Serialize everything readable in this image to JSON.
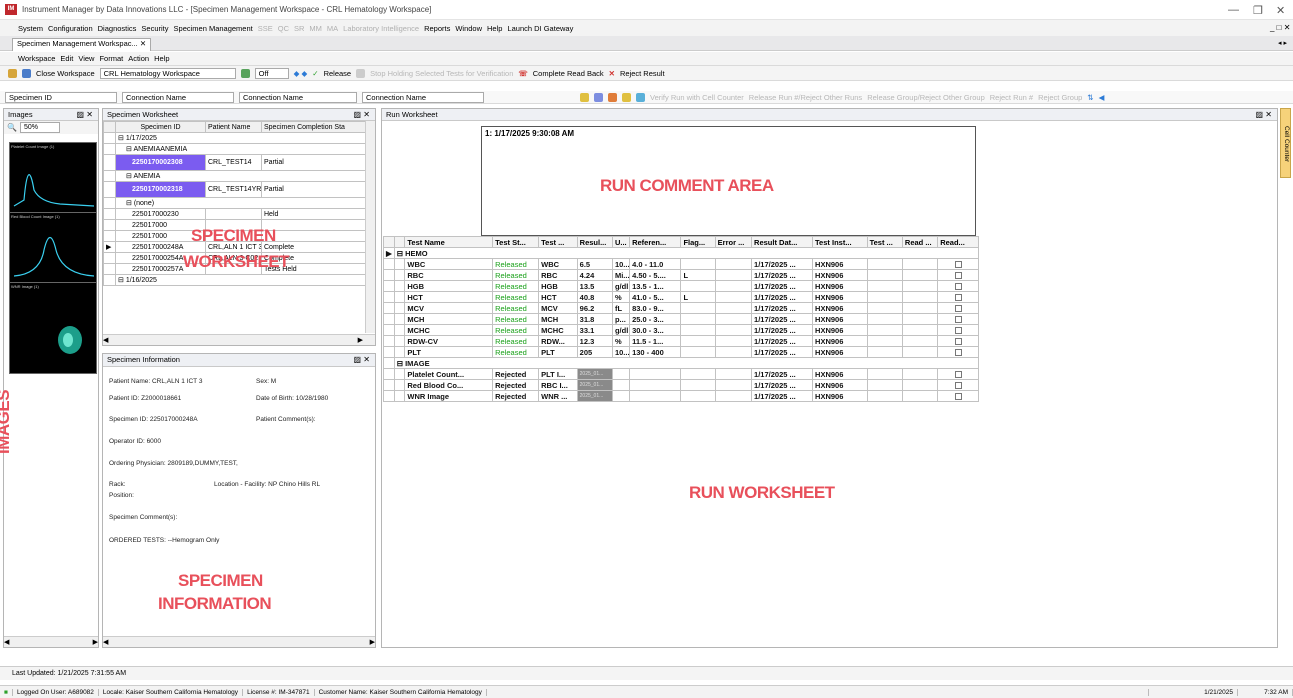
{
  "app": {
    "title": "Instrument Manager by Data Innovations LLC - [Specimen Management Workspace - CRL Hematology Workspace]",
    "logo": "IM"
  },
  "menubar": [
    "System",
    "Configuration",
    "Diagnostics",
    "Security",
    "Specimen Management",
    "SSE",
    "QC",
    "SR",
    "MM",
    "MA",
    "Laboratory Intelligence",
    "Reports",
    "Window",
    "Help",
    "Launch DI Gateway"
  ],
  "menubar_disabled": [
    "SSE",
    "QC",
    "SR",
    "MM",
    "MA",
    "Laboratory Intelligence"
  ],
  "doc_tab": {
    "label": "Specimen Management Workspac...",
    "close": "✕"
  },
  "nav_arrows": "◂ ▸",
  "toolbar1": {
    "items": [
      "Workspace",
      "Edit",
      "View",
      "Format",
      "Action",
      "Help"
    ]
  },
  "toolbar2": {
    "close_workspace": "Close Workspace",
    "workspace_select": "CRL Hematology Workspace",
    "off_select": "Off",
    "release": "Release",
    "stop_holding": "Stop Holding Selected Tests for Verification",
    "complete_read_back": "Complete Read Back",
    "reject_result": "Reject Result"
  },
  "toolbar3": {
    "specimen_id": "Specimen ID",
    "connection1": "Connection Name",
    "connection2": "Connection Name",
    "connection3": "Connection Name",
    "verify_run": "Verify Run with Cell Counter",
    "release_run": "Release Run #/Reject Other Runs",
    "release_group": "Release Group/Reject Other Group",
    "reject_run": "Reject Run #",
    "reject_group": "Reject Group"
  },
  "images_panel": {
    "title": "Images",
    "zoom": "50%",
    "thumbs": [
      "Platelet Count Image (1)",
      "Red Blood Count Image (1)",
      "WNR Image (1)"
    ],
    "overlay": "IMAGES"
  },
  "specimen_worksheet": {
    "title": "Specimen Worksheet",
    "columns": [
      "Specimen ID",
      "Patient Name",
      "Specimen Completion Sta"
    ],
    "group1": "1/17/2025",
    "sub1": "ANEMIAANEMIA",
    "row1": {
      "id": "2250170002308",
      "name": "CRL_TEST14",
      "status": "Partial"
    },
    "sub2": "ANEMIA",
    "row2": {
      "id": "2250170002318",
      "name": "CRL_TEST14YR",
      "status": "Partial"
    },
    "sub3": "(none)",
    "rows": [
      {
        "id": "225017000230",
        "name": "",
        "status": "Held"
      },
      {
        "id": "225017000",
        "name": "",
        "status": ""
      },
      {
        "id": "225017000",
        "name": "",
        "status": ""
      },
      {
        "id": "225017000248A",
        "name": "CRL,ALN 1 ICT 3",
        "status": "Complete"
      },
      {
        "id": "225017000254A",
        "name": "CRL,ALN 3 C02",
        "status": "Complete"
      },
      {
        "id": "225017000257A",
        "name": "",
        "status": "Tests Held"
      }
    ],
    "group2": "1/16/2025",
    "overlay1": "SPECIMEN",
    "overlay2": "WORKSHEET"
  },
  "specimen_info": {
    "title": "Specimen Information",
    "patient_name": "Patient Name:  CRL,ALN 1 ICT 3",
    "sex": "Sex:  M",
    "patient_id": "Patient ID:  Z2000018661",
    "dob": "Date of Birth:  10/28/1980",
    "specimen_id": "Specimen ID:  225017000248A",
    "comments": "Patient Comment(s):",
    "operator": "Operator ID:  6000",
    "physician": "Ordering Physician:  2809189,DUMMY,TEST,",
    "rack": "Rack:",
    "location": "Location - Facility:  NP Chino Hills RL",
    "position": "Position:",
    "spec_comments": "Specimen Comment(s):",
    "ordered": "ORDERED TESTS:  --Hemogram Only",
    "overlay1": "SPECIMEN",
    "overlay2": "INFORMATION"
  },
  "run_worksheet": {
    "title": "Run Worksheet",
    "comment_header": "1: 1/17/2025 9:30:08 AM",
    "comment_overlay": "RUN COMMENT AREA",
    "columns": [
      "Test Name",
      "Test St...",
      "Test ...",
      "Resul...",
      "U...",
      "Referen...",
      "Flag...",
      "Error ...",
      "Result Dat...",
      "Test Inst...",
      "Test ...",
      "Read ...",
      "Read..."
    ],
    "group1": "HEMO",
    "hemo_rows": [
      {
        "name": "WBC",
        "status": "Released",
        "code": "WBC",
        "result": "6.5",
        "unit": "10...",
        "ref": "4.0 - 11.0",
        "flag": "",
        "date": "1/17/2025 ...",
        "inst": "HXN906"
      },
      {
        "name": "RBC",
        "status": "Released",
        "code": "RBC",
        "result": "4.24",
        "unit": "Mi...",
        "ref": "4.50 - 5....",
        "flag": "L",
        "date": "1/17/2025 ...",
        "inst": "HXN906"
      },
      {
        "name": "HGB",
        "status": "Released",
        "code": "HGB",
        "result": "13.5",
        "unit": "g/dl",
        "ref": "13.5 - 1...",
        "flag": "",
        "date": "1/17/2025 ...",
        "inst": "HXN906"
      },
      {
        "name": "HCT",
        "status": "Released",
        "code": "HCT",
        "result": "40.8",
        "unit": "%",
        "ref": "41.0 - 5...",
        "flag": "L",
        "date": "1/17/2025 ...",
        "inst": "HXN906"
      },
      {
        "name": "MCV",
        "status": "Released",
        "code": "MCV",
        "result": "96.2",
        "unit": "fL",
        "ref": "83.0 - 9...",
        "flag": "",
        "date": "1/17/2025 ...",
        "inst": "HXN906"
      },
      {
        "name": "MCH",
        "status": "Released",
        "code": "MCH",
        "result": "31.8",
        "unit": "p...",
        "ref": "25.0 - 3...",
        "flag": "",
        "date": "1/17/2025 ...",
        "inst": "HXN906"
      },
      {
        "name": "MCHC",
        "status": "Released",
        "code": "MCHC",
        "result": "33.1",
        "unit": "g/dl",
        "ref": "30.0 - 3...",
        "flag": "",
        "date": "1/17/2025 ...",
        "inst": "HXN906"
      },
      {
        "name": "RDW-CV",
        "status": "Released",
        "code": "RDW...",
        "result": "12.3",
        "unit": "%",
        "ref": "11.5 - 1...",
        "flag": "",
        "date": "1/17/2025 ...",
        "inst": "HXN906"
      },
      {
        "name": "PLT",
        "status": "Released",
        "code": "PLT",
        "result": "205",
        "unit": "10...",
        "ref": "130 - 400",
        "flag": "",
        "date": "1/17/2025 ...",
        "inst": "HXN906"
      }
    ],
    "group2": "IMAGE",
    "image_rows": [
      {
        "name": "Platelet Count...",
        "status": "Rejected",
        "code": "PLT I...",
        "result": "2025_01...",
        "date": "1/17/2025 ...",
        "inst": "HXN906"
      },
      {
        "name": "Red Blood Co...",
        "status": "Rejected",
        "code": "RBC I...",
        "result": "2025_01...",
        "date": "1/17/2025 ...",
        "inst": "HXN906"
      },
      {
        "name": "WNR Image",
        "status": "Rejected",
        "code": "WNR ...",
        "result": "2025_01...",
        "date": "1/17/2025 ...",
        "inst": "HXN906"
      }
    ],
    "overlay": "RUN WORKSHEET"
  },
  "side_tab": "Cell Counter",
  "last_updated": "Last Updated:  1/21/2025 7:31:55 AM",
  "statusbar": {
    "user": "Logged On User: A689082",
    "locale": "Locale: Kaiser Southern California Hematology",
    "license": "License #: IM-347871",
    "customer": "Customer Name: Kaiser Southern California Hematology",
    "date": "1/21/2025",
    "time": "7:32 AM"
  },
  "colors": {
    "accent": "#e8505b",
    "selected": "#7b5cf0",
    "released": "#18a018"
  }
}
